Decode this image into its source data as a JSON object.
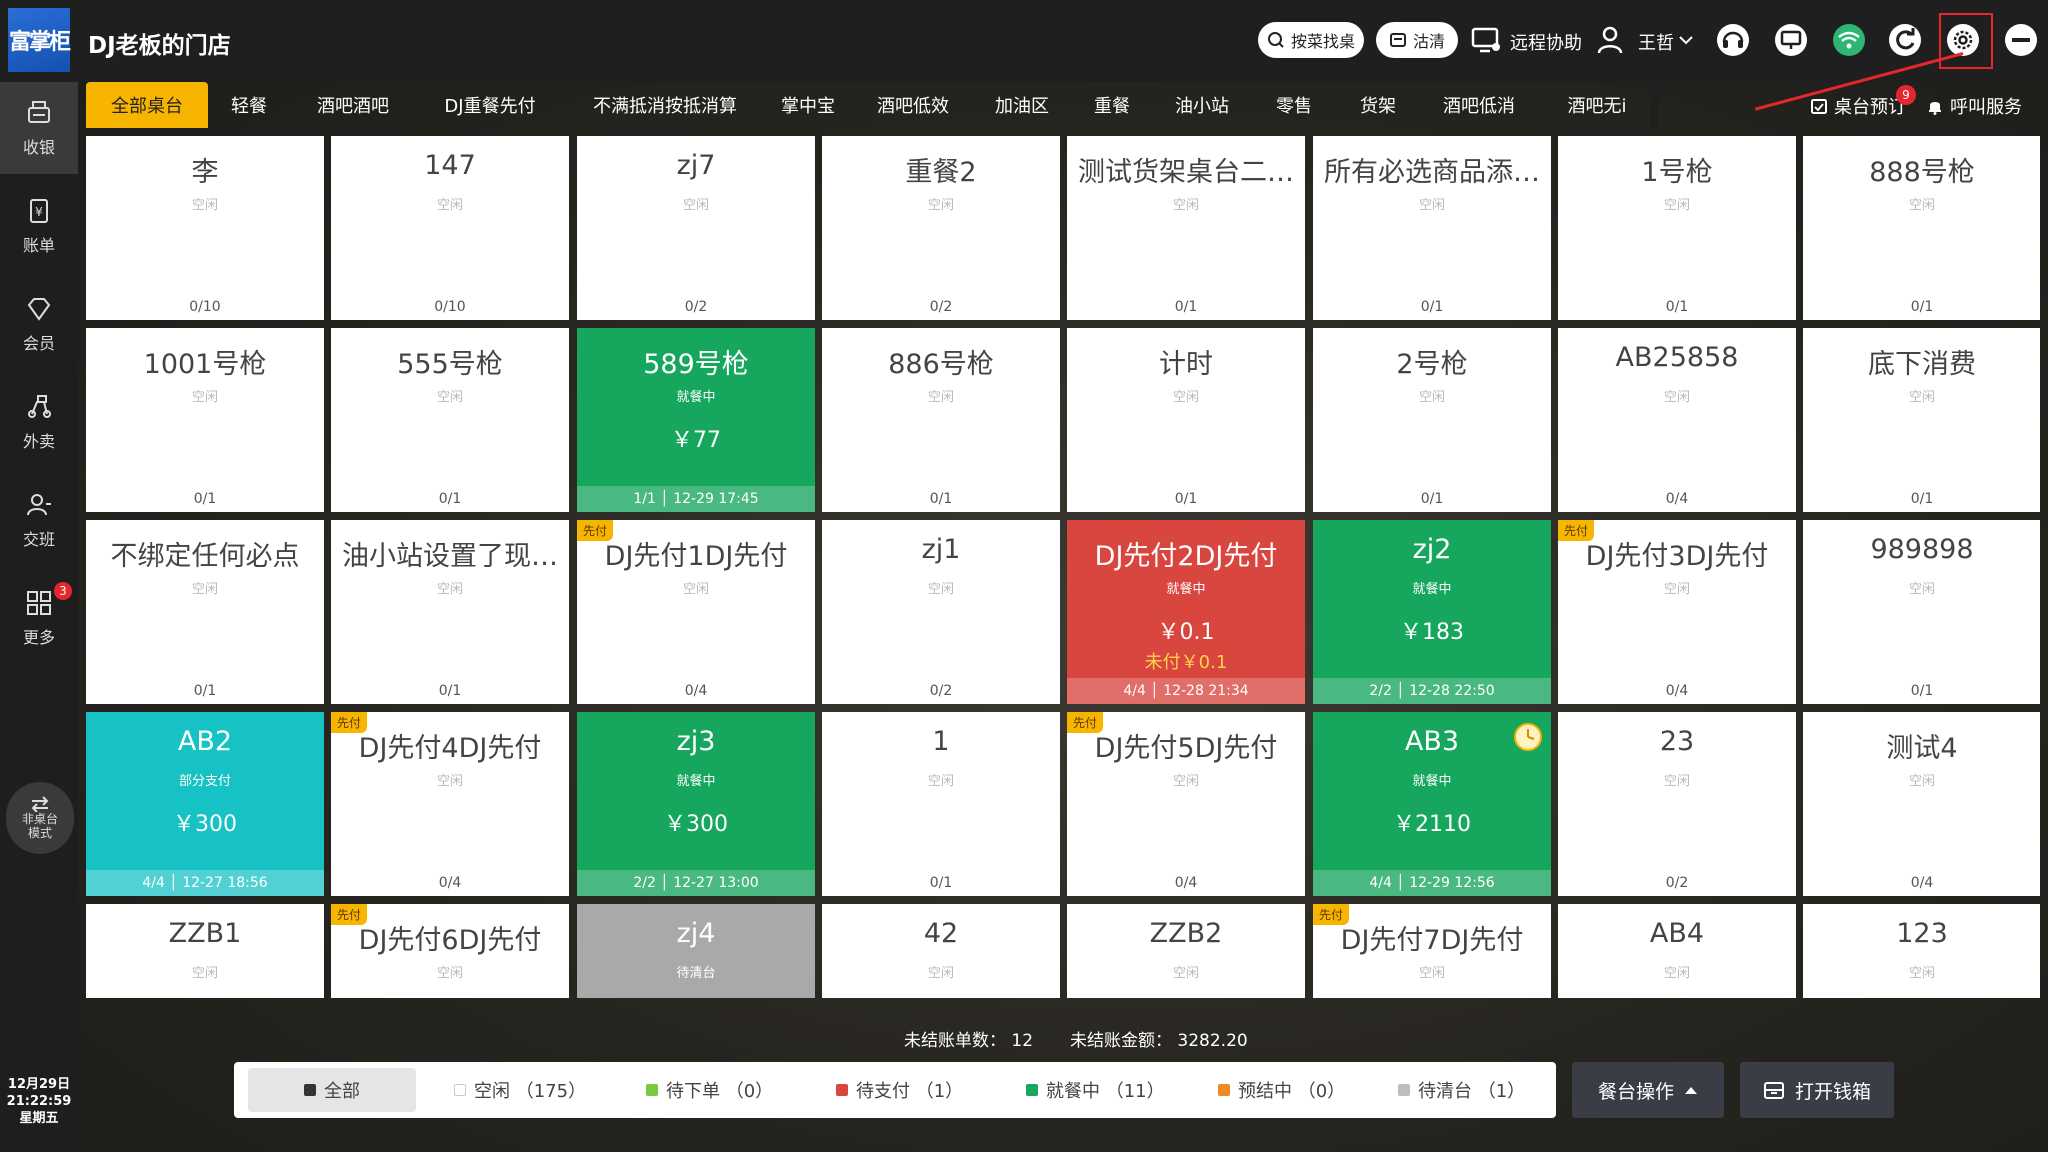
{
  "header": {
    "logo_text": "富掌柜",
    "store_name": "DJ老板的门店",
    "search_dish_label": "按菜找桌",
    "clean_label": "沽清",
    "remote_assist_label": "远程协助",
    "user_name": "王哲"
  },
  "sidebar": {
    "items": [
      {
        "label": "收银",
        "icon": "cashier-icon"
      },
      {
        "label": "账单",
        "icon": "bill-icon"
      },
      {
        "label": "会员",
        "icon": "member-icon"
      },
      {
        "label": "外卖",
        "icon": "delivery-icon"
      },
      {
        "label": "交班",
        "icon": "shift-icon"
      },
      {
        "label": "更多",
        "icon": "more-grid-icon"
      }
    ],
    "more_badge": "3",
    "mode_line1": "非桌台",
    "mode_line2": "模式",
    "date": "12月29日",
    "time": "21:22:59",
    "weekday": "星期五"
  },
  "tabs": [
    "全部桌台",
    "轻餐",
    "酒吧酒吧",
    "DJ重餐先付",
    "不满抵消按抵消算",
    "掌中宝",
    "酒吧低效",
    "加油区",
    "重餐",
    "油小站",
    "零售",
    "货架",
    "酒吧低消",
    "酒吧无i"
  ],
  "actions": {
    "reserve_label": "桌台预订",
    "reserve_badge": "9",
    "call_label": "呼叫服务"
  },
  "tables": [
    {
      "name": "李",
      "status": "空闲",
      "foot": "0/10",
      "state": "idle"
    },
    {
      "name": "147",
      "status": "空闲",
      "foot": "0/10",
      "state": "idle"
    },
    {
      "name": "zj7",
      "status": "空闲",
      "foot": "0/2",
      "state": "idle"
    },
    {
      "name": "重餐2",
      "status": "空闲",
      "foot": "0/2",
      "state": "idle"
    },
    {
      "name": "测试货架桌台二…",
      "status": "空闲",
      "foot": "0/1",
      "state": "idle"
    },
    {
      "name": "所有必选商品添…",
      "status": "空闲",
      "foot": "0/1",
      "state": "idle"
    },
    {
      "name": "1号枪",
      "status": "空闲",
      "foot": "0/1",
      "state": "idle"
    },
    {
      "name": "888号枪",
      "status": "空闲",
      "foot": "0/1",
      "state": "idle"
    },
    {
      "name": "1001号枪",
      "status": "空闲",
      "foot": "0/1",
      "state": "idle"
    },
    {
      "name": "555号枪",
      "status": "空闲",
      "foot": "0/1",
      "state": "idle"
    },
    {
      "name": "589号枪",
      "status": "就餐中",
      "amount": "￥77",
      "foot": "1/1 │ 12-29 17:45",
      "state": "busy"
    },
    {
      "name": "886号枪",
      "status": "空闲",
      "foot": "0/1",
      "state": "idle"
    },
    {
      "name": "计时",
      "status": "空闲",
      "foot": "0/1",
      "state": "idle"
    },
    {
      "name": "2号枪",
      "status": "空闲",
      "foot": "0/1",
      "state": "idle"
    },
    {
      "name": "AB25858",
      "status": "空闲",
      "foot": "0/4",
      "state": "idle"
    },
    {
      "name": "底下消费",
      "status": "空闲",
      "foot": "0/1",
      "state": "idle"
    },
    {
      "name": "不绑定任何必点",
      "status": "空闲",
      "foot": "0/1",
      "state": "idle"
    },
    {
      "name": "油小站设置了现…",
      "status": "空闲",
      "foot": "0/1",
      "state": "idle"
    },
    {
      "name": "DJ先付1DJ先付",
      "status": "空闲",
      "foot": "0/4",
      "state": "idle",
      "prepay": "先付"
    },
    {
      "name": "zj1",
      "status": "空闲",
      "foot": "0/2",
      "state": "idle"
    },
    {
      "name": "DJ先付2DJ先付",
      "status": "就餐中",
      "amount": "￥0.1",
      "unpaid": "未付￥0.1",
      "foot": "4/4 │ 12-28 21:34",
      "state": "unpaid"
    },
    {
      "name": "zj2",
      "status": "就餐中",
      "amount": "￥183",
      "foot": "2/2 │ 12-28 22:50",
      "state": "busy"
    },
    {
      "name": "DJ先付3DJ先付",
      "status": "空闲",
      "foot": "0/4",
      "state": "idle",
      "prepay": "先付"
    },
    {
      "name": "989898",
      "status": "空闲",
      "foot": "0/1",
      "state": "idle"
    },
    {
      "name": "AB2",
      "status": "部分支付",
      "amount": "￥300",
      "foot": "4/4 │ 12-27 18:56",
      "state": "partial"
    },
    {
      "name": "DJ先付4DJ先付",
      "status": "空闲",
      "foot": "0/4",
      "state": "idle",
      "prepay": "先付"
    },
    {
      "name": "zj3",
      "status": "就餐中",
      "amount": "￥300",
      "foot": "2/2 │ 12-27 13:00",
      "state": "busy"
    },
    {
      "name": "1",
      "status": "空闲",
      "foot": "0/1",
      "state": "idle"
    },
    {
      "name": "DJ先付5DJ先付",
      "status": "空闲",
      "foot": "0/4",
      "state": "idle",
      "prepay": "先付"
    },
    {
      "name": "AB3",
      "status": "就餐中",
      "amount": "￥2110",
      "foot": "4/4 │ 12-29 12:56",
      "state": "busy",
      "timer": true
    },
    {
      "name": "23",
      "status": "空闲",
      "foot": "0/2",
      "state": "idle"
    },
    {
      "name": "测试4",
      "status": "空闲",
      "foot": "0/4",
      "state": "idle"
    },
    {
      "name": "ZZB1",
      "status": "空闲",
      "foot": "",
      "state": "idle"
    },
    {
      "name": "DJ先付6DJ先付",
      "status": "空闲",
      "foot": "",
      "state": "idle",
      "prepay": "先付"
    },
    {
      "name": "zj4",
      "status": "待清台",
      "foot": "",
      "state": "cleaning"
    },
    {
      "name": "42",
      "status": "空闲",
      "foot": "",
      "state": "idle"
    },
    {
      "name": "ZZB2",
      "status": "空闲",
      "foot": "",
      "state": "idle"
    },
    {
      "name": "DJ先付7DJ先付",
      "status": "空闲",
      "foot": "",
      "state": "idle",
      "prepay": "先付"
    },
    {
      "name": "AB4",
      "status": "空闲",
      "foot": "",
      "state": "idle"
    },
    {
      "name": "123",
      "status": "空闲",
      "foot": "",
      "state": "idle"
    }
  ],
  "summary": {
    "unsettled_count_label": "未结账单数：",
    "unsettled_count": "12",
    "unsettled_amount_label": "未结账金额：",
    "unsettled_amount": "3282.20"
  },
  "filters": [
    {
      "label": "全部",
      "color": "#333333"
    },
    {
      "label": "空闲 （175）",
      "color": "#ffffff"
    },
    {
      "label": "待下单 （0）",
      "color": "#7ac943"
    },
    {
      "label": "待支付 （1）",
      "color": "#d9463f"
    },
    {
      "label": "就餐中 （11）",
      "color": "#17a65e"
    },
    {
      "label": "预结中 （0）",
      "color": "#f08a24"
    },
    {
      "label": "待清台 （1）",
      "color": "#bdbdbd"
    }
  ],
  "bottom_actions": {
    "table_ops_label": "餐台操作",
    "open_drawer_label": "打开钱箱"
  }
}
